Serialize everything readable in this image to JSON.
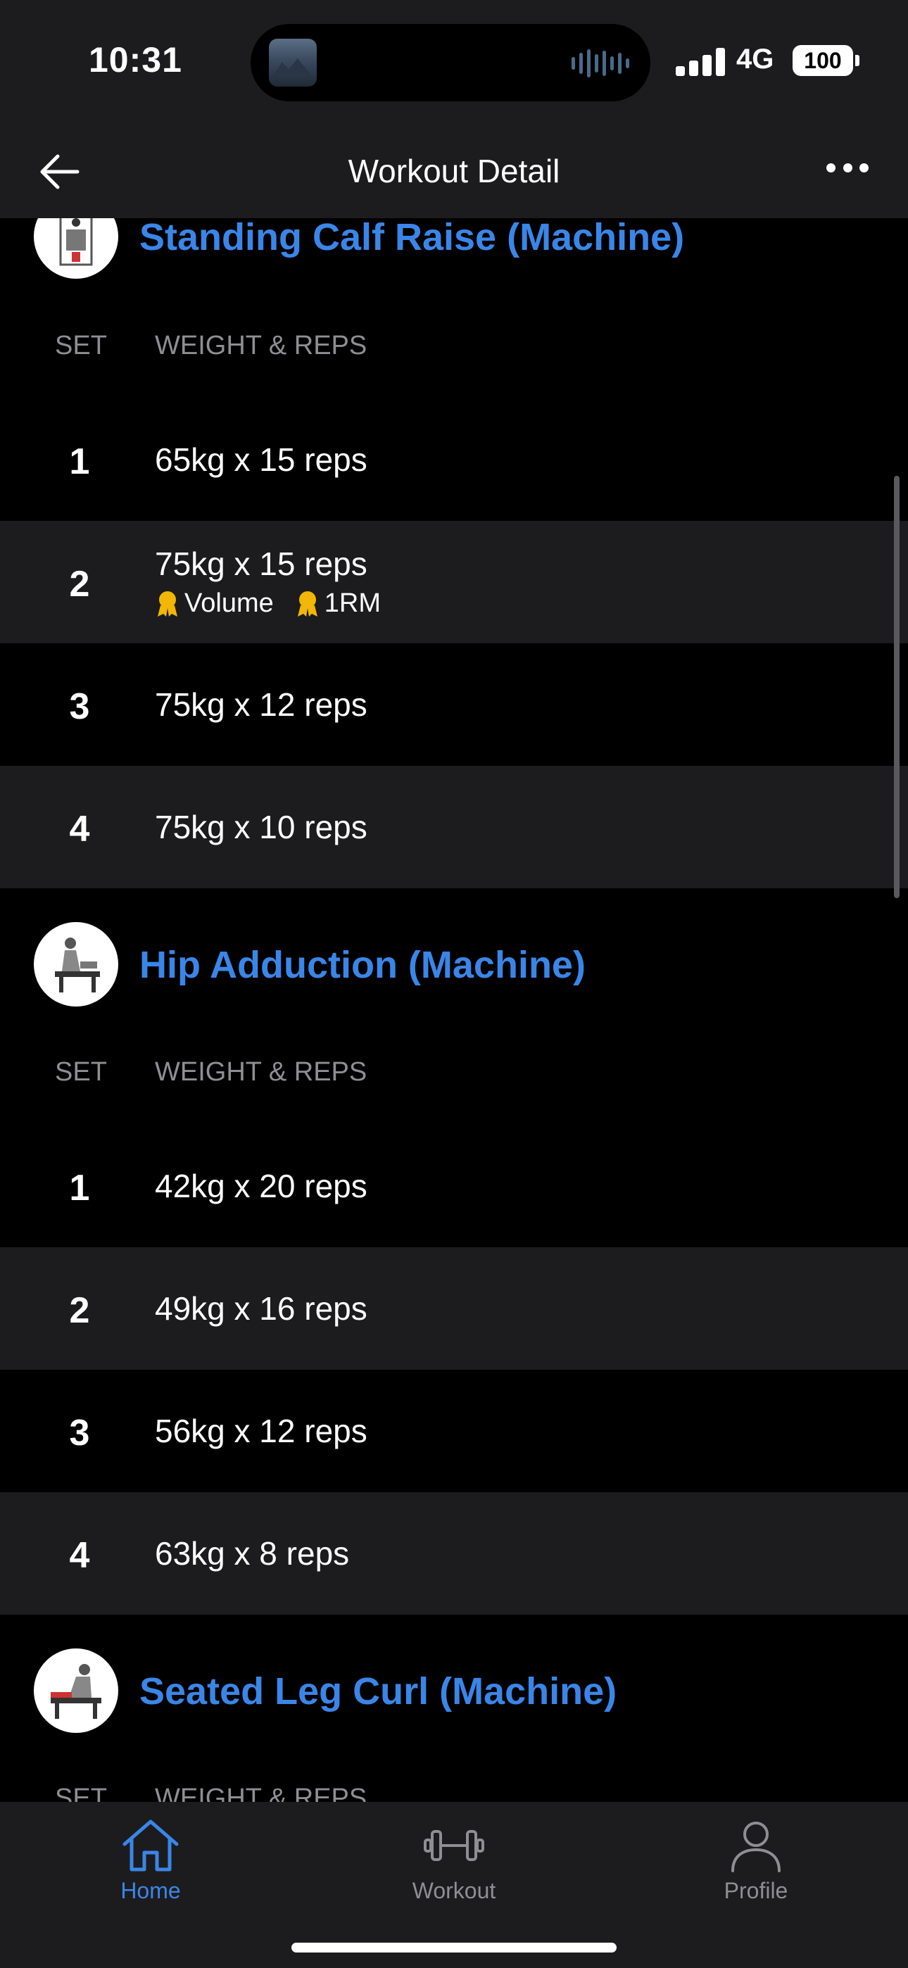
{
  "status_bar": {
    "time": "10:31",
    "network": "4G",
    "battery": "100"
  },
  "header": {
    "title": "Workout Detail"
  },
  "column_headers": {
    "set": "SET",
    "weight_reps": "WEIGHT & REPS"
  },
  "exercises": [
    {
      "name": "Standing Calf Raise (Machine)",
      "sets": [
        {
          "num": "1",
          "value": "65kg x 15 reps"
        },
        {
          "num": "2",
          "value": "75kg x 15 reps",
          "badges": [
            "Volume",
            "1RM"
          ]
        },
        {
          "num": "3",
          "value": "75kg x 12 reps"
        },
        {
          "num": "4",
          "value": "75kg x 10 reps"
        }
      ]
    },
    {
      "name": "Hip Adduction (Machine)",
      "sets": [
        {
          "num": "1",
          "value": "42kg x 20 reps"
        },
        {
          "num": "2",
          "value": "49kg x 16 reps"
        },
        {
          "num": "3",
          "value": "56kg x 12 reps"
        },
        {
          "num": "4",
          "value": "63kg x 8 reps"
        }
      ]
    },
    {
      "name": "Seated Leg Curl (Machine)",
      "sets": []
    }
  ],
  "tabbar": {
    "home": "Home",
    "workout": "Workout",
    "profile": "Profile"
  },
  "colors": {
    "accent": "#3a86e8",
    "medal": "#f2b705"
  }
}
